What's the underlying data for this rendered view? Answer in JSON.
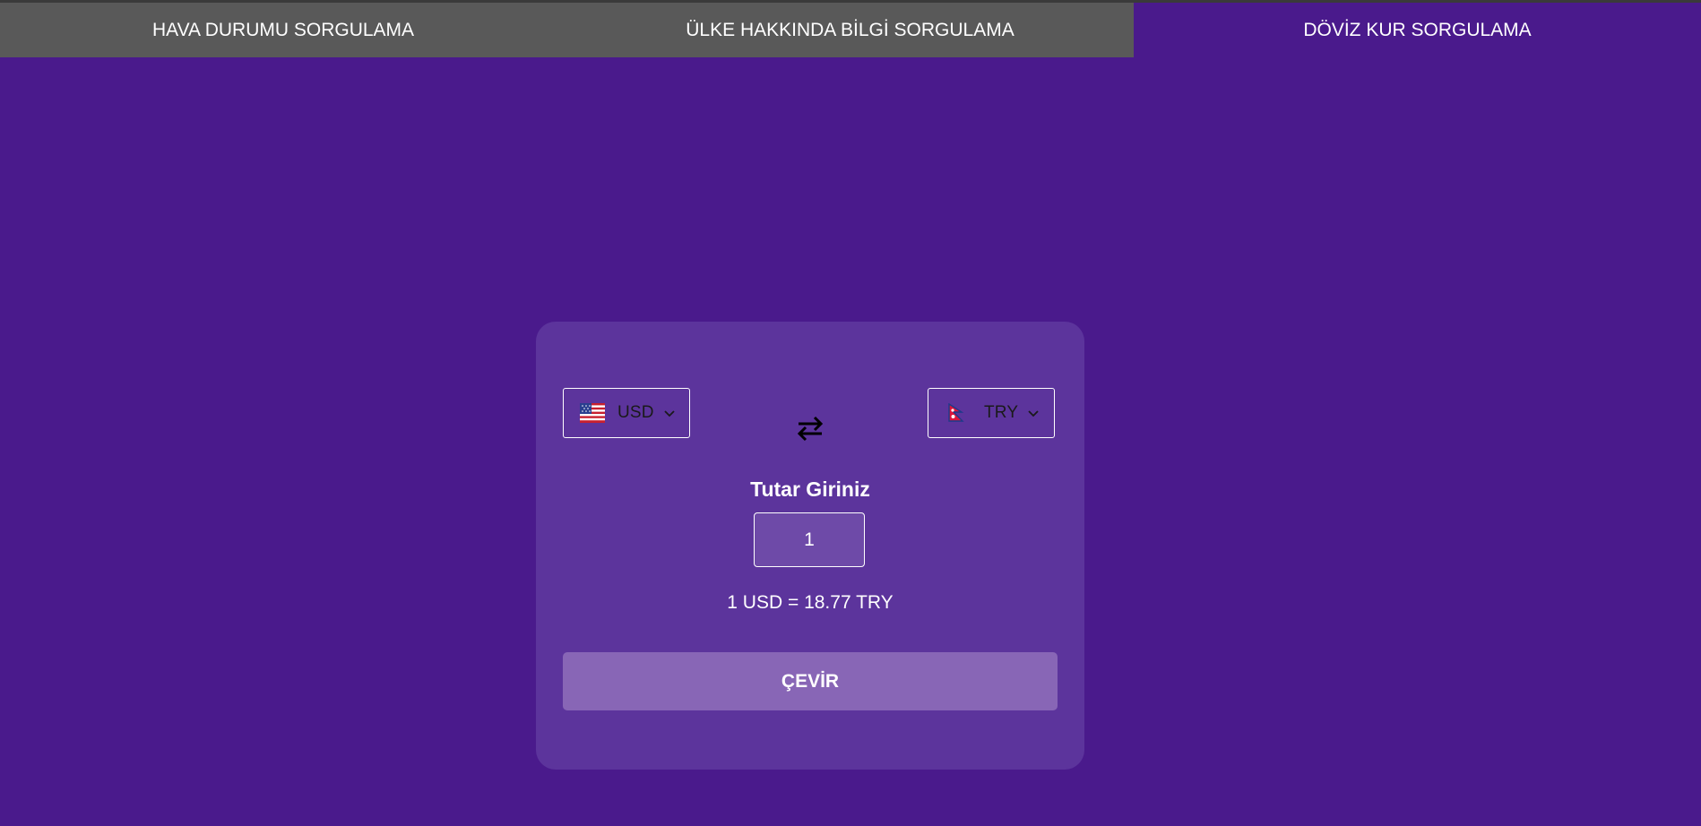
{
  "tabs": [
    {
      "label": "HAVA DURUMU SORGULAMA",
      "active": false
    },
    {
      "label": "ÜLKE HAKKINDA BİLGİ SORGULAMA",
      "active": false
    },
    {
      "label": "DÖVİZ KUR SORGULAMA",
      "active": true
    }
  ],
  "converter": {
    "from": {
      "code": "USD",
      "flag_icon": "us-flag-icon"
    },
    "to": {
      "code": "TRY",
      "flag_icon": "np-flag-icon"
    },
    "swap_icon": "swap-arrows-icon",
    "amount_label": "Tutar Giriniz",
    "amount_value": "1",
    "result_text": "1 USD = 18.77 TRY",
    "convert_label": "ÇEVİR"
  },
  "colors": {
    "background": "#4a1a8c",
    "tab_inactive": "#595959",
    "card": "#5c349c",
    "button": "#8866b6"
  }
}
